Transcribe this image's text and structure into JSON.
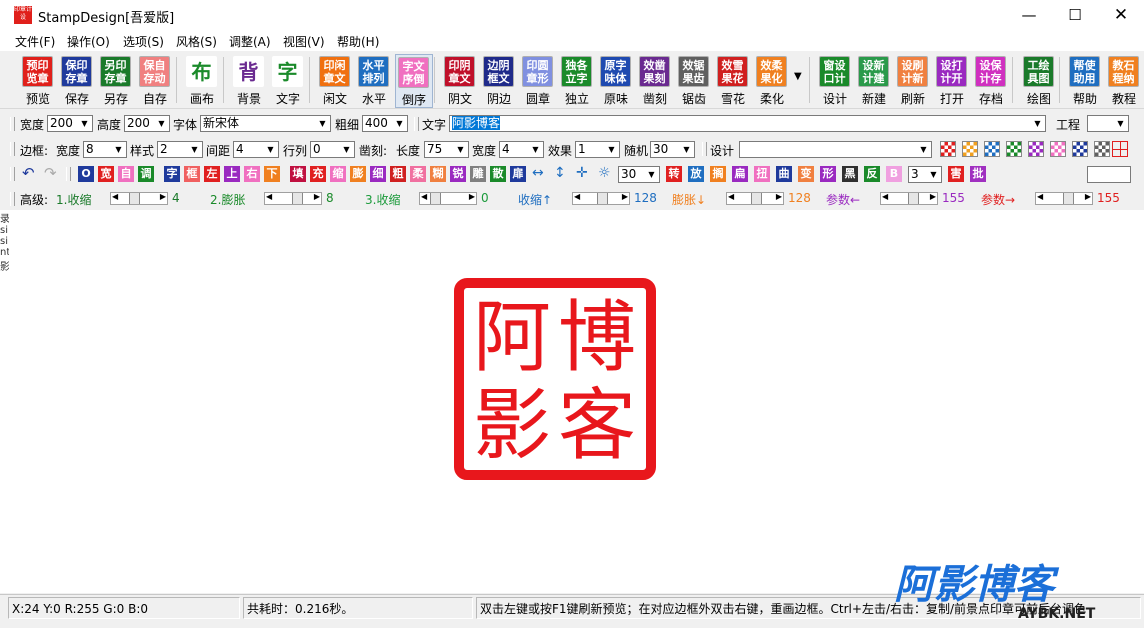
{
  "window": {
    "title": "StampDesign[吾爱版]",
    "app_icon_text": "印章计设"
  },
  "menu": [
    "文件(F)",
    "操作(O)",
    "选项(S)",
    "风格(S)",
    "调整(A)",
    "视图(V)",
    "帮助(H)"
  ],
  "toolbar": {
    "buttons": [
      {
        "icon": "预印览章",
        "label": "预览",
        "color": "#e0201b"
      },
      {
        "icon": "保印存章",
        "label": "保存",
        "color": "#1f3a9c"
      },
      {
        "icon": "另印存章",
        "label": "另存",
        "color": "#1a7a2a"
      },
      {
        "icon": "保自存动",
        "label": "自存",
        "color": "#f08080"
      },
      {
        "icon": "布",
        "label": "画布",
        "color": "#ffffff"
      },
      {
        "icon": "背",
        "label": "背景",
        "color": "#ffffff"
      },
      {
        "icon": "字",
        "label": "文字",
        "color": "#ffffff"
      },
      {
        "icon": "印闲章文",
        "label": "闲文",
        "color": "#f07010"
      },
      {
        "icon": "水平排列",
        "label": "水平",
        "color": "#1f6ec0"
      },
      {
        "icon": "字文序倒",
        "label": "倒序",
        "color": "#f070c0"
      },
      {
        "icon": "印阴章文",
        "label": "阴文",
        "color": "#c0102a"
      },
      {
        "icon": "边阴框文",
        "label": "阴边",
        "color": "#1f2a8a"
      },
      {
        "icon": "印圆章形",
        "label": "圆章",
        "color": "#8090e0"
      },
      {
        "icon": "独各立字",
        "label": "独立",
        "color": "#1a8a2a"
      },
      {
        "icon": "原字味体",
        "label": "原味",
        "color": "#1f4ab0"
      },
      {
        "icon": "效凿果刻",
        "label": "凿刻",
        "color": "#6a2a90"
      },
      {
        "icon": "效锯果齿",
        "label": "锯齿",
        "color": "#606060"
      },
      {
        "icon": "效雪果花",
        "label": "雪花",
        "color": "#d02020"
      },
      {
        "icon": "效柔果化",
        "label": "柔化",
        "color": "#f08020"
      },
      {
        "icon": "窗设口计",
        "label": "设计",
        "color": "#1a8a2a"
      },
      {
        "icon": "设新计建",
        "label": "新建",
        "color": "#2a9a4a"
      },
      {
        "icon": "设刷计新",
        "label": "刷新",
        "color": "#f08040"
      },
      {
        "icon": "设打计开",
        "label": "打开",
        "color": "#9a2ac0"
      },
      {
        "icon": "设保计存",
        "label": "存档",
        "color": "#d030c0"
      },
      {
        "icon": "工绘具图",
        "label": "绘图",
        "color": "#1a7a2a"
      },
      {
        "icon": "帮使助用",
        "label": "帮助",
        "color": "#1f6ec0"
      },
      {
        "icon": "教石程纳",
        "label": "教程",
        "color": "#f08020"
      }
    ]
  },
  "row1": {
    "width_label": "宽度",
    "width": "200",
    "height_label": "高度",
    "height": "200",
    "font_label": "字体",
    "font": "新宋体",
    "weight_label": "粗细",
    "weight": "400",
    "text_label": "文字",
    "text": "阿影博客",
    "project_label": "工程",
    "project": ""
  },
  "row2": {
    "border_label": "边框:",
    "bwidth_label": "宽度",
    "bwidth": "8",
    "style_label": "样式",
    "style": "2",
    "spacing_label": "间距",
    "spacing": "4",
    "rowcol_label": "行列",
    "rowcol": "0",
    "carve_label": "凿刻:",
    "length_label": "长度",
    "length": "75",
    "cwidth_label": "宽度",
    "cwidth": "4",
    "effect_label": "效果",
    "effect": "1",
    "random_label": "随机",
    "random": "30",
    "design_label": "设计",
    "design": ""
  },
  "row3": {
    "chars": [
      {
        "t": "O",
        "c": "#1f3a9c"
      },
      {
        "t": "宽",
        "c": "#e02020"
      },
      {
        "t": "自",
        "c": "#f070c0"
      },
      {
        "t": "调",
        "c": "#1a8a2a"
      },
      {
        "t": "字",
        "c": "#1f3a9c"
      },
      {
        "t": "框",
        "c": "#f06060"
      },
      {
        "t": "左",
        "c": "#e02020"
      },
      {
        "t": "上",
        "c": "#9a2ac0"
      },
      {
        "t": "右",
        "c": "#f070c0"
      },
      {
        "t": "下",
        "c": "#f08020"
      },
      {
        "t": "填",
        "c": "#c01040"
      },
      {
        "t": "充",
        "c": "#e02020"
      },
      {
        "t": "缩",
        "c": "#f070c0"
      },
      {
        "t": "膨",
        "c": "#f08020"
      },
      {
        "t": "细",
        "c": "#9a2ac0"
      },
      {
        "t": "粗",
        "c": "#d02020"
      },
      {
        "t": "柔",
        "c": "#f070a0"
      },
      {
        "t": "糊",
        "c": "#f08040"
      },
      {
        "t": "锐",
        "c": "#9a2ac0"
      },
      {
        "t": "雕",
        "c": "#808080"
      },
      {
        "t": "散",
        "c": "#1a8a2a"
      },
      {
        "t": "扉",
        "c": "#1f3a9c"
      }
    ],
    "value": "30",
    "chars2": [
      {
        "t": "转",
        "c": "#e02020"
      },
      {
        "t": "放",
        "c": "#1f6ec0"
      },
      {
        "t": "搁",
        "c": "#f08020"
      },
      {
        "t": "扁",
        "c": "#9a2ac0"
      },
      {
        "t": "扭",
        "c": "#f070c0"
      },
      {
        "t": "曲",
        "c": "#1f3a9c"
      },
      {
        "t": "变",
        "c": "#f08040"
      },
      {
        "t": "形",
        "c": "#9a2ac0"
      },
      {
        "t": "黑",
        "c": "#303030"
      },
      {
        "t": "反",
        "c": "#1a8a2a"
      },
      {
        "t": "B",
        "c": "#f0a0e0"
      }
    ],
    "value2": "3",
    "chars3": [
      {
        "t": "害",
        "c": "#e02020"
      },
      {
        "t": "批",
        "c": "#a030c0"
      }
    ]
  },
  "row4": {
    "label": "高级:",
    "sliders": [
      {
        "name": "1.收缩",
        "value": "4",
        "color": "#1a7a2a",
        "pos": 0.3
      },
      {
        "name": "2.膨胀",
        "value": "8",
        "color": "#1a8a2a",
        "pos": 0.6
      },
      {
        "name": "3.收缩",
        "value": "0",
        "color": "#1a9a3a",
        "pos": 0.05
      },
      {
        "name": "收缩↑",
        "value": "128",
        "color": "#1f6ec0",
        "pos": 0.5
      },
      {
        "name": "膨胀↓",
        "value": "128",
        "color": "#f08020",
        "pos": 0.5
      },
      {
        "name": "参数←",
        "value": "155",
        "color": "#9a2ac0",
        "pos": 0.6
      },
      {
        "name": "参数→",
        "value": "155",
        "color": "#e02020",
        "pos": 0.6
      }
    ]
  },
  "stamp": {
    "chars": [
      "博",
      "客",
      "阿",
      "影"
    ],
    "color": "#e8171c"
  },
  "left_fragment": "录\nsi\nsi\nnt\n影",
  "status": {
    "coords": "X:24 Y:0 R:255 G:0 B:0",
    "time": "共耗时：0.216秒。",
    "hint": "双击左键或按F1键刷新预览；在对应边框外双击右键，重画边框。Ctrl+左击/右击：复制/前景点印章可前后台调色"
  },
  "watermark": {
    "title": "阿影博客",
    "subtitle": "AYBK.NET",
    "color": "#1b6fd8"
  }
}
